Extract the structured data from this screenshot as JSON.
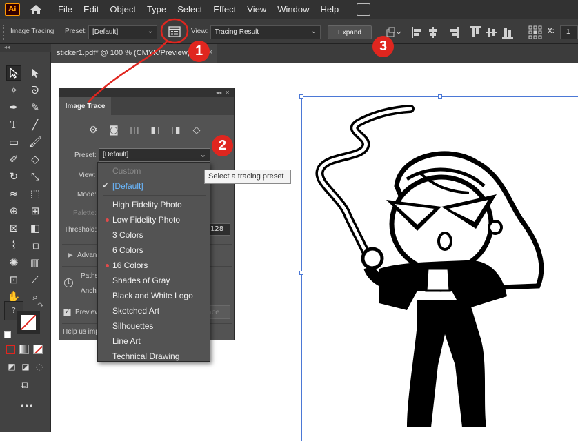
{
  "menubar": {
    "app_logo": "Ai",
    "items": [
      "File",
      "Edit",
      "Object",
      "Type",
      "Select",
      "Effect",
      "View",
      "Window",
      "Help"
    ]
  },
  "controlbar": {
    "title": "Image Tracing",
    "preset_label": "Preset:",
    "preset_value": "[Default]",
    "view_label": "View:",
    "view_value": "Tracing Result",
    "expand_label": "Expand",
    "x_label": "X:",
    "x_value": "1"
  },
  "document_tab": {
    "title": "sticker1.pdf* @ 100 % (CMYK/Preview)",
    "close": "×"
  },
  "image_trace_panel": {
    "tab_label": "Image Trace",
    "preset_label": "Preset:",
    "preset_value": "[Default]",
    "view_label": "View:",
    "mode_label": "Mode:",
    "palette_label": "Palette:",
    "threshold_label": "Threshold:",
    "threshold_value": "128",
    "advanced_label": "Advanced",
    "paths_label": "Paths",
    "anchors_label": "Anchors",
    "preview_label": "Preview",
    "trace_label": "Trace",
    "help_text": "Help us improve"
  },
  "preset_dropdown": {
    "items": [
      {
        "label": "Custom",
        "disabled": true,
        "checked": false,
        "dot": false
      },
      {
        "label": "[Default]",
        "disabled": false,
        "checked": true,
        "dot": false
      },
      {
        "label": "High Fidelity Photo",
        "disabled": false,
        "checked": false,
        "dot": false
      },
      {
        "label": "Low Fidelity Photo",
        "disabled": false,
        "checked": false,
        "dot": true
      },
      {
        "label": "3 Colors",
        "disabled": false,
        "checked": false,
        "dot": false
      },
      {
        "label": "6 Colors",
        "disabled": false,
        "checked": false,
        "dot": false
      },
      {
        "label": "16 Colors",
        "disabled": false,
        "checked": false,
        "dot": true
      },
      {
        "label": "Shades of Gray",
        "disabled": false,
        "checked": false,
        "dot": false
      },
      {
        "label": "Black and White Logo",
        "disabled": false,
        "checked": false,
        "dot": false
      },
      {
        "label": "Sketched Art",
        "disabled": false,
        "checked": false,
        "dot": false
      },
      {
        "label": "Silhouettes",
        "disabled": false,
        "checked": false,
        "dot": false
      },
      {
        "label": "Line Art",
        "disabled": false,
        "checked": false,
        "dot": false
      },
      {
        "label": "Technical Drawing",
        "disabled": false,
        "checked": false,
        "dot": false
      }
    ]
  },
  "tooltip": {
    "text": "Select a tracing preset"
  },
  "callouts": [
    "1",
    "2",
    "3"
  ],
  "toolbar": {
    "more_label": "•••",
    "fill_marker": "?"
  },
  "colors": {
    "accent_red": "#e0261f",
    "selection_blue": "#4b78d6",
    "highlight": "#6ab8ff"
  }
}
